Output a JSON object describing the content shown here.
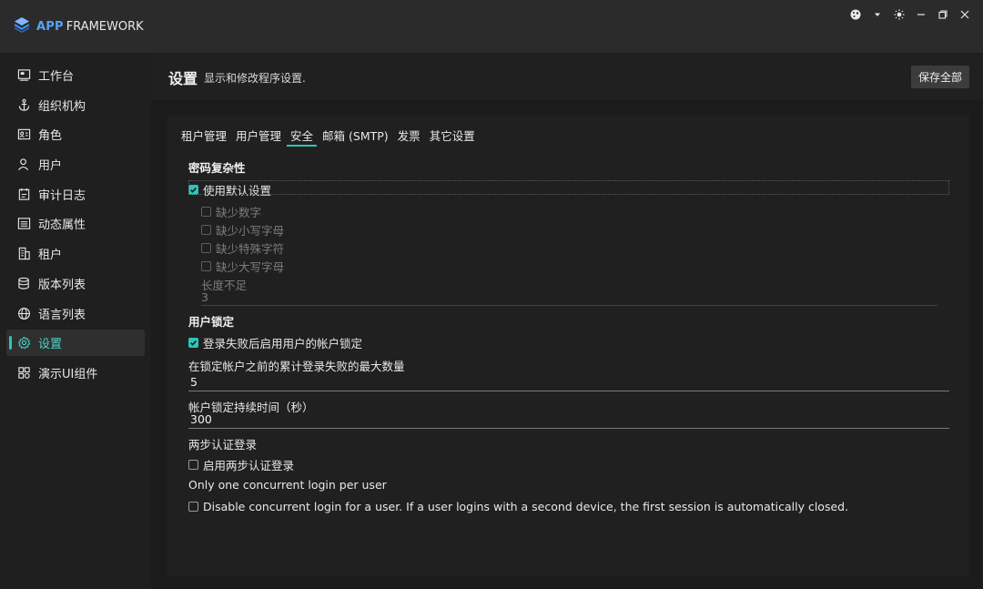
{
  "app": {
    "brand_primary": "APP",
    "brand_secondary": "FRAMEWORK",
    "accent_color": "#2ec4b6"
  },
  "window_controls": [
    "theme-icon",
    "chevron-down-icon",
    "sun-icon",
    "minimize-icon",
    "restore-icon",
    "close-icon"
  ],
  "sidebar": {
    "items": [
      {
        "label": "工作台",
        "icon": "dashboard-icon"
      },
      {
        "label": "组织机构",
        "icon": "anchor-icon"
      },
      {
        "label": "角色",
        "icon": "id-card-icon"
      },
      {
        "label": "用户",
        "icon": "user-icon"
      },
      {
        "label": "审计日志",
        "icon": "calendar-icon"
      },
      {
        "label": "动态属性",
        "icon": "list-icon"
      },
      {
        "label": "租户",
        "icon": "building-icon"
      },
      {
        "label": "版本列表",
        "icon": "database-icon"
      },
      {
        "label": "语言列表",
        "icon": "globe-icon"
      },
      {
        "label": "设置",
        "icon": "gear-icon",
        "active": true
      },
      {
        "label": "演示UI组件",
        "icon": "grid-icon"
      }
    ]
  },
  "header": {
    "title": "设置",
    "description": "显示和修改程序设置.",
    "save_all_label": "保存全部"
  },
  "tabs": [
    {
      "label": "租户管理"
    },
    {
      "label": "用户管理"
    },
    {
      "label": "安全",
      "active": true
    },
    {
      "label": "邮箱 (SMTP)"
    },
    {
      "label": "发票"
    },
    {
      "label": "其它设置"
    }
  ],
  "security": {
    "password_complexity": {
      "title": "密码复杂性",
      "use_default": {
        "label": "使用默认设置",
        "checked": true
      },
      "options": [
        {
          "label": "缺少数字",
          "checked": false
        },
        {
          "label": "缺少小写字母",
          "checked": false
        },
        {
          "label": "缺少特殊字符",
          "checked": false
        },
        {
          "label": "缺少大写字母",
          "checked": false
        }
      ],
      "length_label": "长度不足",
      "length_value": "3"
    },
    "user_lockout": {
      "title": "用户锁定",
      "enable": {
        "label": "登录失败后启用用户的帐户锁定",
        "checked": true
      },
      "max_failed_label": "在锁定帐户之前的累计登录失败的最大数量",
      "max_failed_value": "5",
      "duration_label": "帐户锁定持续时间（秒）",
      "duration_value": "300"
    },
    "two_factor": {
      "title": "两步认证登录",
      "enable": {
        "label": "启用两步认证登录",
        "checked": false
      }
    },
    "concurrent": {
      "title": "Only one concurrent login per user",
      "disable": {
        "label": "Disable concurrent login for a user. If a user logins with a second device, the first session is automatically closed.",
        "checked": false
      }
    }
  }
}
